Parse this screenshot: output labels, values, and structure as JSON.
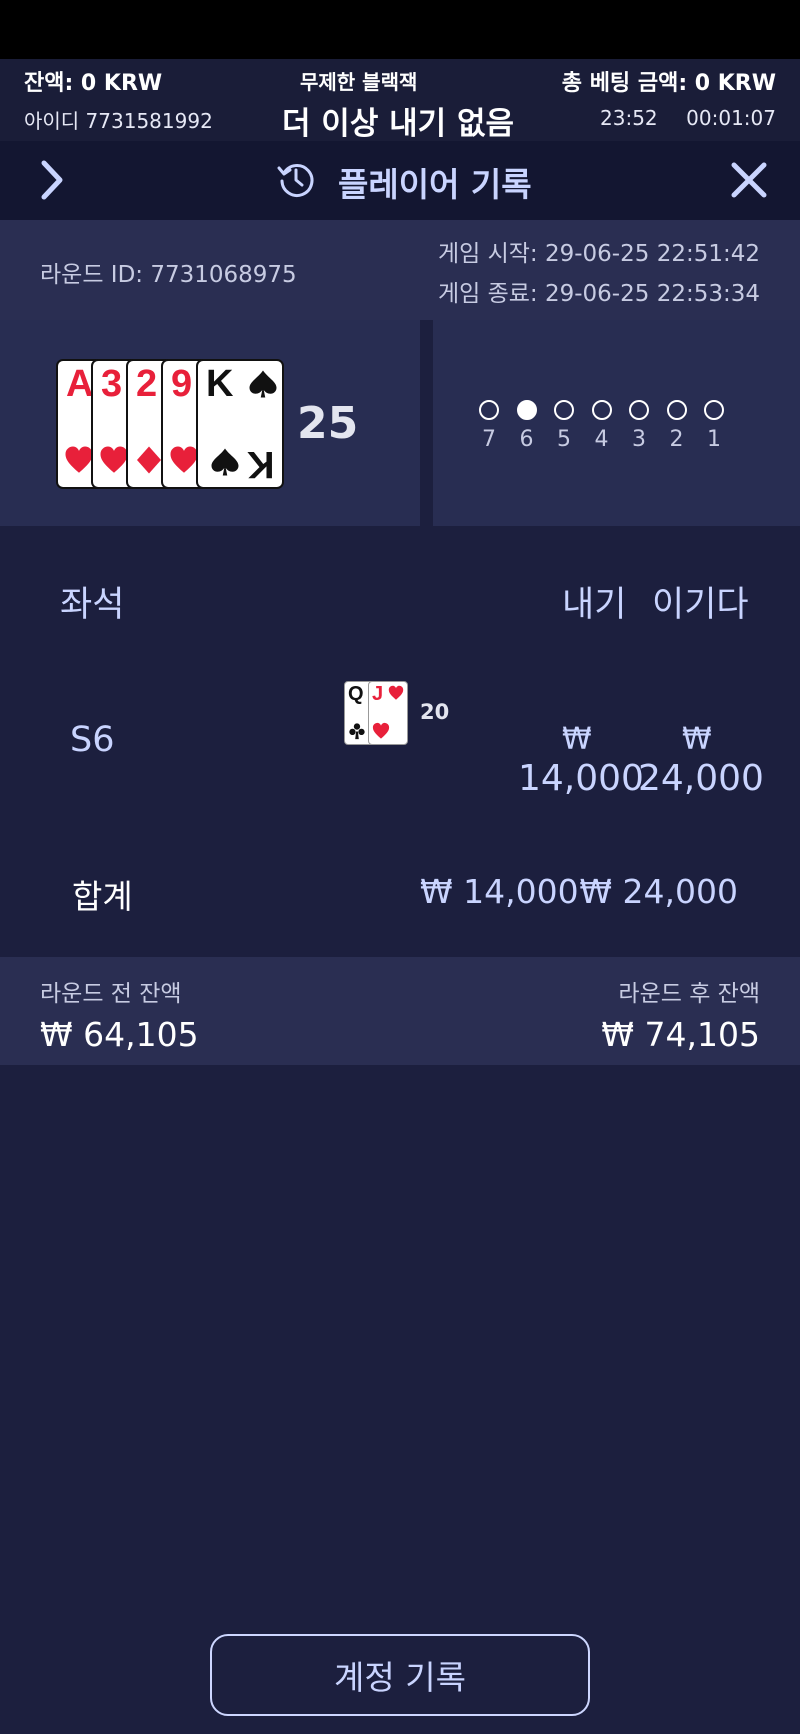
{
  "header": {
    "balance": "잔액: 0 KRW",
    "game_name": "무제한 블랙잭",
    "total_bet": "총 베팅 금액: 0 KRW",
    "user_id": "아이디 7731581992",
    "status_message": "더 이상 내기 없음",
    "clock": "23:52",
    "timer": "00:01:07"
  },
  "history_header": {
    "title": "플레이어 기록",
    "icons": [
      "chevron-right-icon",
      "history-icon",
      "close-icon"
    ]
  },
  "round": {
    "round_id": "라운드 ID: 7731068975",
    "game_start": "게임 시작: 29-06-25 22:51:42",
    "game_end": "게임 종료: 29-06-25 22:53:34"
  },
  "dealer": {
    "cards": [
      {
        "rank": "A",
        "suit": "hearts",
        "color": "#e8203a"
      },
      {
        "rank": "3",
        "suit": "hearts",
        "color": "#e8203a"
      },
      {
        "rank": "2",
        "suit": "diamonds",
        "color": "#e8203a"
      },
      {
        "rank": "9",
        "suit": "hearts",
        "color": "#e8203a"
      },
      {
        "rank": "K",
        "suit": "spades",
        "color": "#111111"
      }
    ],
    "score": "25"
  },
  "seats": {
    "numbers": [
      "7",
      "6",
      "5",
      "4",
      "3",
      "2",
      "1"
    ],
    "selected": "6"
  },
  "table": {
    "col_seat": "좌석",
    "col_bet": "내기",
    "col_win": "이기다",
    "rows": [
      {
        "seat": "S6",
        "cards": [
          {
            "rank": "Q",
            "suit": "clubs",
            "color": "#111111"
          },
          {
            "rank": "J",
            "suit": "hearts",
            "color": "#e8203a"
          }
        ],
        "score": "20",
        "currency": "₩",
        "bet": "14,000",
        "win": "24,000"
      }
    ],
    "total_label": "합계",
    "total_bet": "₩ 14,000",
    "total_win": "₩ 24,000"
  },
  "balance": {
    "before_label": "라운드 전 잔액",
    "before_value": "₩ 64,105",
    "after_label": "라운드 후 잔액",
    "after_value": "₩ 74,105"
  },
  "account_button": "계정 기록",
  "colors": {
    "background": "#1c1f3e",
    "panel": "#282d52",
    "accent_text": "#c9d4ff",
    "red_suit": "#e8203a"
  }
}
